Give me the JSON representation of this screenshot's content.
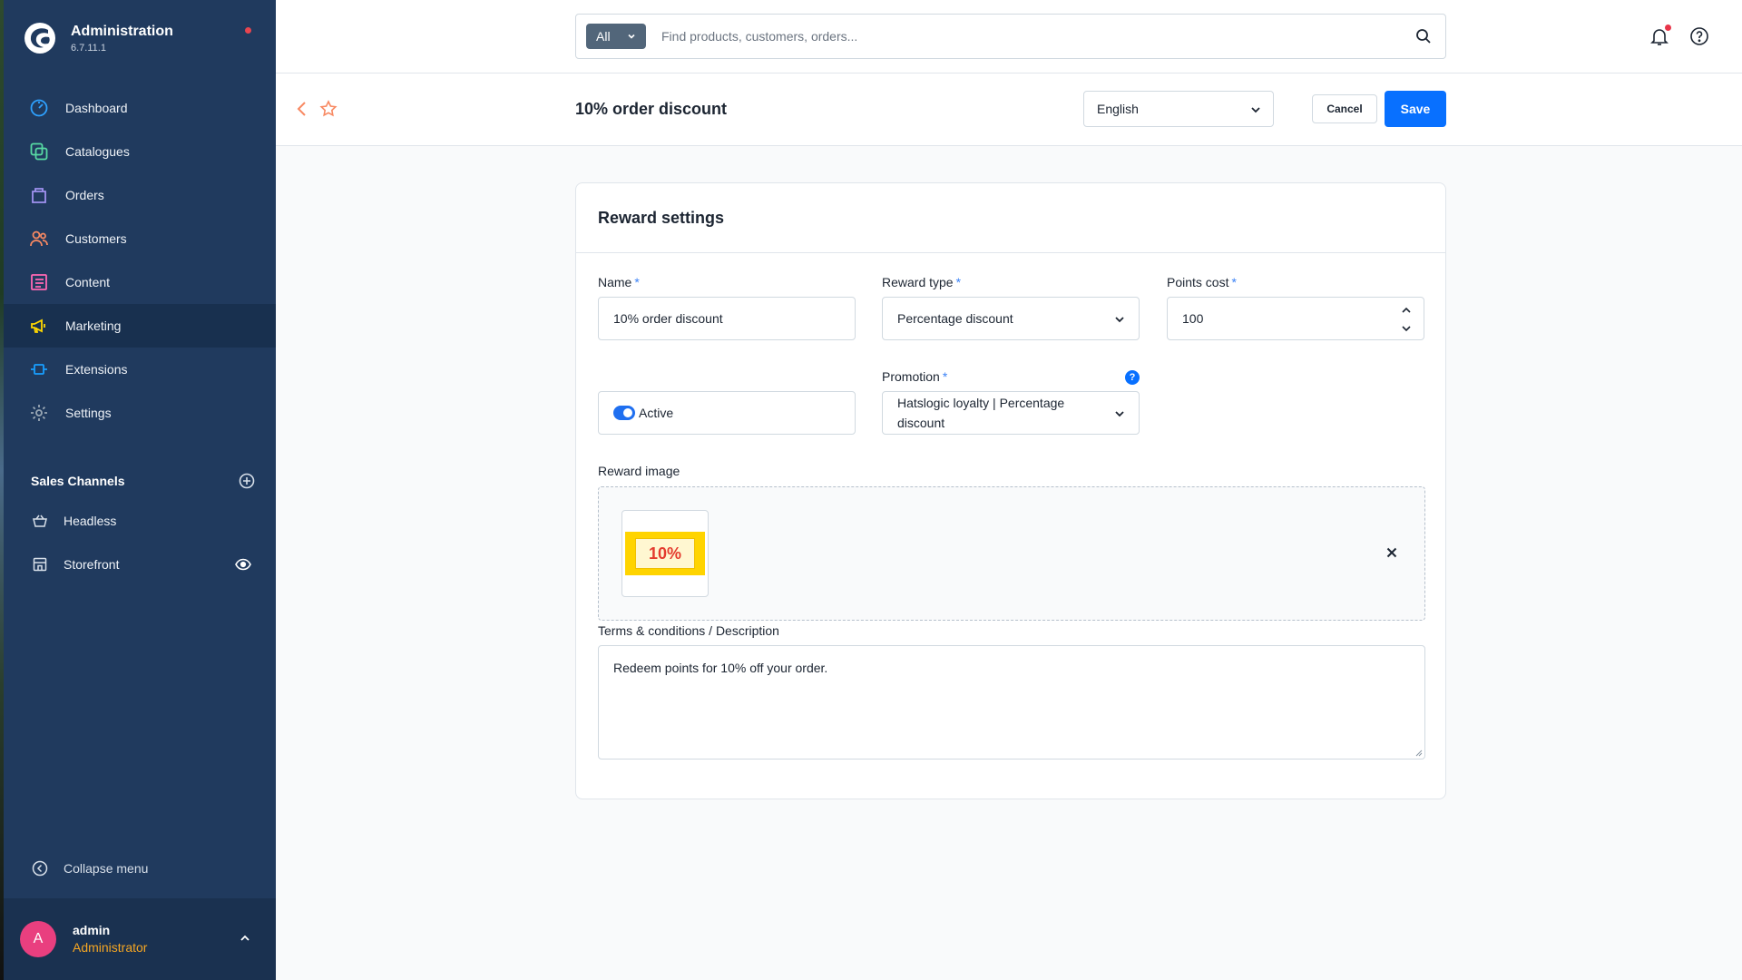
{
  "app": {
    "title": "Administration",
    "version": "6.7.11.1"
  },
  "sidebar": {
    "items": [
      {
        "label": "Dashboard",
        "icon": "dashboard-icon",
        "color": "#2ea1ff"
      },
      {
        "label": "Catalogues",
        "icon": "catalogues-icon",
        "color": "#57d9a3"
      },
      {
        "label": "Orders",
        "icon": "orders-icon",
        "color": "#a092f0"
      },
      {
        "label": "Customers",
        "icon": "customers-icon",
        "color": "#f88962"
      },
      {
        "label": "Content",
        "icon": "content-icon",
        "color": "#ff68b4"
      },
      {
        "label": "Marketing",
        "icon": "marketing-icon",
        "color": "#ffd700"
      },
      {
        "label": "Extensions",
        "icon": "extensions-icon",
        "color": "#189eff"
      },
      {
        "label": "Settings",
        "icon": "settings-icon",
        "color": "#9aa8b5"
      }
    ],
    "active_item": "Marketing",
    "sales_channels_title": "Sales Channels",
    "sales_channels": [
      {
        "label": "Headless",
        "icon": "basket-icon"
      },
      {
        "label": "Storefront",
        "icon": "storefront-icon"
      }
    ],
    "collapse_label": "Collapse menu",
    "user": {
      "initial": "A",
      "name": "admin",
      "role": "Administrator"
    }
  },
  "header": {
    "search_type": "All",
    "search_placeholder": "Find products, customers, orders..."
  },
  "smartbar": {
    "title": "10% order discount",
    "language": "English",
    "cancel_label": "Cancel",
    "save_label": "Save"
  },
  "card": {
    "title": "Reward settings",
    "name_label": "Name",
    "name_value": "10% order discount",
    "reward_type_label": "Reward type",
    "reward_type_value": "Percentage discount",
    "points_cost_label": "Points cost",
    "points_cost_value": "100",
    "active_label": "Active",
    "active": true,
    "promotion_label": "Promotion",
    "promotion_value": "Hatslogic loyalty | Percentage discount",
    "reward_image_label": "Reward image",
    "reward_image_text": "10%",
    "terms_label": "Terms & conditions / Description",
    "terms_value": "Redeem points for 10% off your order.",
    "required_marker": "*",
    "help_marker": "?"
  },
  "colors": {
    "sidebar_bg": "#203a5e",
    "primary": "#0870ff",
    "role": "#f5a623",
    "avatar": "#e93f7f"
  }
}
